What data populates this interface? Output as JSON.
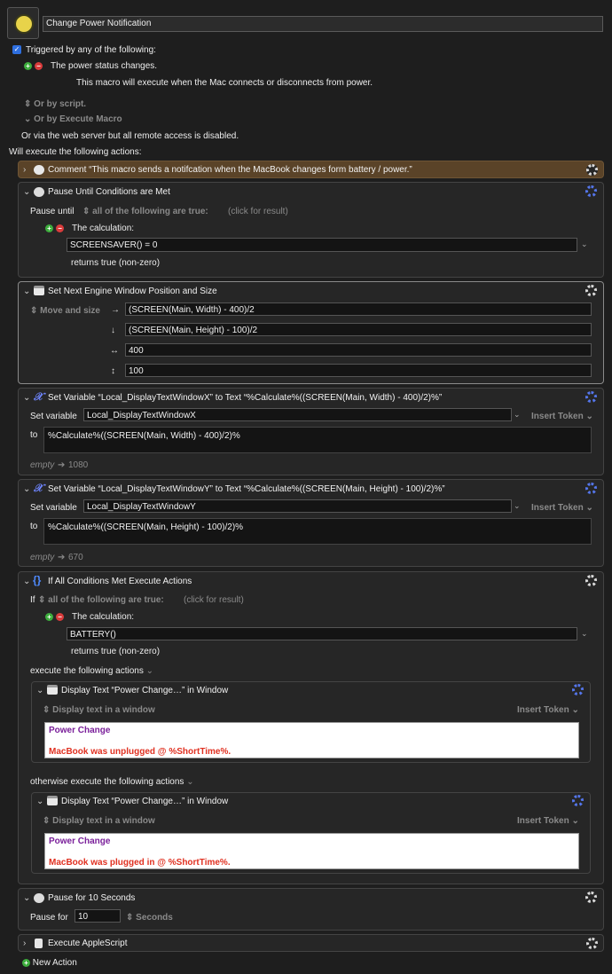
{
  "macro": {
    "name": "Change Power Notification"
  },
  "triggers": {
    "header": "Triggered by any of the following:",
    "trigger_label": "The power status changes.",
    "trigger_desc": "This macro will execute when the Mac connects or disconnects from power.",
    "by_script": "Or by script.",
    "by_execute_macro": "Or by Execute Macro",
    "web_server": "Or via the web server but all remote access is disabled."
  },
  "actions_header": "Will execute the following actions:",
  "comment": {
    "title": "Comment “This macro sends a notifcation when the MacBook changes form battery / power.”"
  },
  "pause_until": {
    "title": "Pause Until Conditions are Met",
    "pause_until_label": "Pause until",
    "condition_mode": "all of the following are true:",
    "click_result": "(click for result)",
    "calc_label": "The calculation:",
    "calc_value": "SCREENSAVER() = 0",
    "returns": "returns true (non-zero)"
  },
  "window_pos": {
    "title": "Set Next Engine Window Position and Size",
    "mode": "Move and size",
    "x_expr": "(SCREEN(Main, Width) - 400)/2",
    "y_expr": "(SCREEN(Main, Height) - 100)/2",
    "width": "400",
    "height": "100"
  },
  "set_var_x": {
    "title": "Set Variable “Local_DisplayTextWindowX” to Text “%Calculate%((SCREEN(Main, Width) - 400)/2)%”",
    "set_label": "Set variable",
    "var_name": "Local_DisplayTextWindowX",
    "insert_token": "Insert Token",
    "to_label": "to",
    "text": "%Calculate%((SCREEN(Main, Width) - 400)/2)%",
    "preview_empty": "empty",
    "preview_value": "1080"
  },
  "set_var_y": {
    "title": "Set Variable “Local_DisplayTextWindowY” to Text “%Calculate%((SCREEN(Main, Height) - 100)/2)%”",
    "set_label": "Set variable",
    "var_name": "Local_DisplayTextWindowY",
    "insert_token": "Insert Token",
    "to_label": "to",
    "text": "%Calculate%((SCREEN(Main, Height) - 100)/2)%",
    "preview_empty": "empty",
    "preview_value": "670"
  },
  "if_block": {
    "title": "If All Conditions Met Execute Actions",
    "if_label": "If",
    "condition_mode": "all of the following are true:",
    "click_result": "(click for result)",
    "calc_label": "The calculation:",
    "calc_value": "BATTERY()",
    "returns": "returns true (non-zero)",
    "then_label": "execute the following actions",
    "else_label": "otherwise execute the following actions"
  },
  "display_unplugged": {
    "title": "Display Text “Power Change…” in Window",
    "mode": "Display text in a window",
    "insert_token": "Insert Token",
    "line1": "Power Change",
    "line2": "MacBook was unplugged @ %ShortTime%."
  },
  "display_plugged": {
    "title": "Display Text “Power Change…” in Window",
    "mode": "Display text in a window",
    "insert_token": "Insert Token",
    "line1": "Power Change",
    "line2": "MacBook was plugged in @ %ShortTime%."
  },
  "pause_for": {
    "title": "Pause for 10 Seconds",
    "label": "Pause for",
    "value": "10",
    "unit": "Seconds"
  },
  "applescript": {
    "title": "Execute AppleScript"
  },
  "new_action": "New Action",
  "colors": {
    "accent": "#2e6fe0",
    "comment_bg": "#5a4328",
    "purple_text": "#7a1f9a",
    "red_text": "#e03020"
  }
}
